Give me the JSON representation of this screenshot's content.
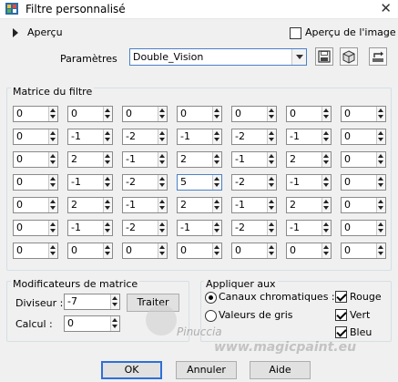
{
  "window": {
    "title": "Filtre personnalisé"
  },
  "apercu": {
    "label": "Aperçu",
    "image_preview_label": "Aperçu de l'image",
    "image_preview_checked": false
  },
  "params": {
    "label": "Paramètres",
    "preset": "Double_Vision"
  },
  "matrix": {
    "title": "Matrice du filtre",
    "rows": [
      [
        "0",
        "0",
        "0",
        "0",
        "0",
        "0",
        "0"
      ],
      [
        "0",
        "-1",
        "-2",
        "-1",
        "-2",
        "-1",
        "0"
      ],
      [
        "0",
        "2",
        "-1",
        "2",
        "-1",
        "2",
        "0"
      ],
      [
        "0",
        "-1",
        "-2",
        "5",
        "-2",
        "-1",
        "0"
      ],
      [
        "0",
        "2",
        "-1",
        "2",
        "-1",
        "2",
        "0"
      ],
      [
        "0",
        "-1",
        "-2",
        "-1",
        "-2",
        "-1",
        "0"
      ],
      [
        "0",
        "0",
        "0",
        "0",
        "0",
        "0",
        "0"
      ]
    ]
  },
  "modifiers": {
    "title": "Modificateurs de matrice",
    "diviseur_label": "Diviseur :",
    "diviseur_value": "-7",
    "calcul_label": "Calcul :",
    "calcul_value": "0",
    "traiter_label": "Traiter"
  },
  "apply": {
    "title": "Appliquer aux",
    "channels_label": "Canaux chromatiques :",
    "gray_label": "Valeurs de gris",
    "channels_selected": true,
    "rouge_label": "Rouge",
    "vert_label": "Vert",
    "bleu_label": "Bleu",
    "rouge_checked": true,
    "vert_checked": true,
    "bleu_checked": true
  },
  "buttons": {
    "ok": "OK",
    "cancel": "Annuler",
    "help": "Aide"
  },
  "watermark": {
    "name": "Pinuccia",
    "site": "www.magicpaint.eu"
  }
}
